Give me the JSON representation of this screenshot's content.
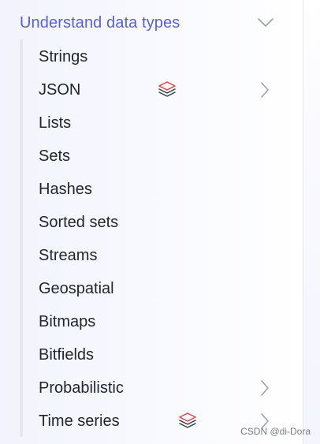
{
  "section": {
    "title": "Understand data types",
    "expanded_icon": "chevron-down-icon"
  },
  "items": [
    {
      "label": "Strings"
    },
    {
      "label": "JSON",
      "badge_icon": "stack-layers-icon",
      "has_submenu": true
    },
    {
      "label": "Lists"
    },
    {
      "label": "Sets"
    },
    {
      "label": "Hashes"
    },
    {
      "label": "Sorted sets"
    },
    {
      "label": "Streams"
    },
    {
      "label": "Geospatial"
    },
    {
      "label": "Bitmaps"
    },
    {
      "label": "Bitfields"
    },
    {
      "label": "Probabilistic",
      "has_submenu": true
    },
    {
      "label": "Time series",
      "badge_icon": "stack-layers-icon",
      "has_submenu": true
    }
  ],
  "watermark": "CSDN @di-Dora",
  "colors": {
    "accent": "#5961d0",
    "text": "#24262e",
    "badge_red": "#d64545",
    "badge_dark": "#3a3d46",
    "chevron": "#9ea1ad",
    "tree_line": "#e6e7ef"
  }
}
